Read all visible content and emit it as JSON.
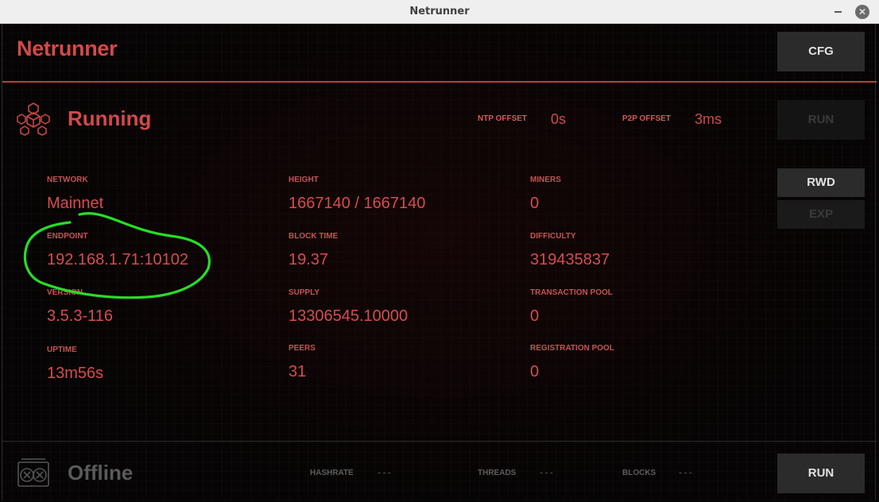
{
  "window": {
    "title": "Netrunner"
  },
  "header": {
    "app_name": "Netrunner",
    "cfg_label": "CFG"
  },
  "node": {
    "status": "Running",
    "status_color": "#d24a4a",
    "ntp_offset_label": "NTP OFFSET",
    "ntp_offset_value": "0s",
    "p2p_offset_label": "P2P OFFSET",
    "p2p_offset_value": "3ms",
    "run_label": "RUN",
    "rwd_label": "RWD",
    "exp_label": "EXP"
  },
  "stats": [
    {
      "label": "NETWORK",
      "value": "Mainnet"
    },
    {
      "label": "ENDPOINT",
      "value": "192.168.1.71:10102"
    },
    {
      "label": "VERSION",
      "value": "3.5.3-116"
    },
    {
      "label": "UPTIME",
      "value": "13m56s"
    },
    {
      "label": "HEIGHT",
      "value": "1667140 / 1667140"
    },
    {
      "label": "BLOCK TIME",
      "value": "19.37"
    },
    {
      "label": "SUPPLY",
      "value": "13306545.10000"
    },
    {
      "label": "PEERS",
      "value": "31"
    },
    {
      "label": "MINERS",
      "value": "0"
    },
    {
      "label": "DIFFICULTY",
      "value": "319435837"
    },
    {
      "label": "TRANSACTION POOL",
      "value": "0"
    },
    {
      "label": "REGISTRATION POOL",
      "value": "0"
    }
  ],
  "miner": {
    "status": "Offline",
    "status_color": "#5a5a5a",
    "hashrate_label": "HASHRATE",
    "hashrate_value": "---",
    "threads_label": "THREADS",
    "threads_value": "---",
    "blocks_label": "BLOCKS",
    "blocks_value": "---",
    "run_label": "RUN"
  },
  "colors": {
    "accent": "#d24a4a",
    "annotation": "#22dd22"
  }
}
